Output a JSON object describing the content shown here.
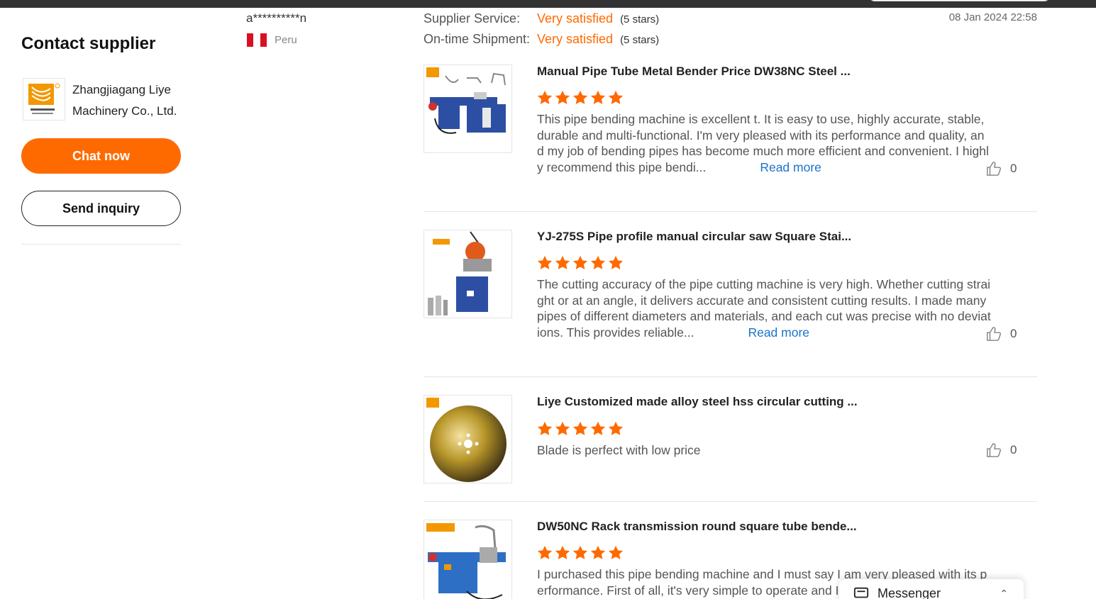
{
  "left": {
    "contact_title": "Contact supplier",
    "supplier_name": "Zhangjiagang Liye Machinery Co., Ltd.",
    "chat_label": "Chat now",
    "inquiry_label": "Send inquiry"
  },
  "reviewer": {
    "name": "a**********n",
    "country": "Peru",
    "flag_colors": [
      "#d91023",
      "#ffffff",
      "#d91023"
    ]
  },
  "ratings": [
    {
      "label": "Supplier Service:",
      "value": "Very satisfied",
      "note": "(5 stars)"
    },
    {
      "label": "On-time Shipment:",
      "value": "Very satisfied",
      "note": "(5 stars)"
    }
  ],
  "date": "08 Jan 2024 22:58",
  "accent_color": "#ff6a00",
  "link_color": "#1a73c8",
  "reviews": [
    {
      "title": "Manual Pipe Tube Metal Bender Price DW38NC Steel ...",
      "stars": 5,
      "text": "This pipe bending machine is excellent t. It is easy to use, highly accurate, stable, durable and multi-functional. I'm very pleased with its performance and quality, and my job of bending pipes has become much more efficient and convenient. I highly recommend this pipe bendi...",
      "read_more": "Read more",
      "likes": "0",
      "thumb_icon": "pipe-bender-image"
    },
    {
      "title": "YJ-275S Pipe profile manual circular saw Square Stai...",
      "stars": 5,
      "text": "The cutting accuracy of the pipe cutting machine is very high. Whether cutting straight or at an angle, it delivers accurate and consistent cutting results. I made many pipes of different diameters and materials, and each cut was precise with no deviations. This provides reliable...",
      "read_more": "Read more",
      "likes": "0",
      "thumb_icon": "circular-saw-image"
    },
    {
      "title": "Liye Customized made alloy steel hss circular cutting ...",
      "stars": 5,
      "text": "Blade is perfect with low price",
      "read_more": "",
      "likes": "0",
      "thumb_icon": "saw-blade-image"
    },
    {
      "title": "DW50NC Rack transmission round square tube bende...",
      "stars": 5,
      "text": "I purchased this pipe bending machine and I must say I am very pleased with its performance. First of all, it's very simple to operate and I have",
      "read_more": "",
      "likes": "",
      "thumb_icon": "tube-bender-image"
    }
  ],
  "messenger": {
    "label": "Messenger"
  }
}
